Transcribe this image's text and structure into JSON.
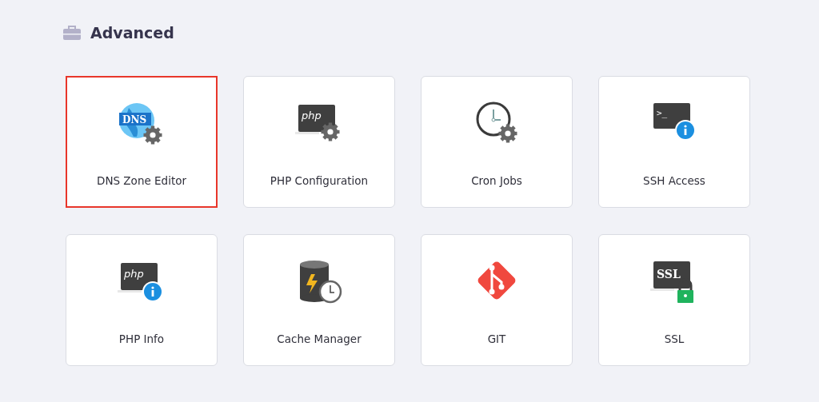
{
  "section": {
    "title": "Advanced"
  },
  "tools": [
    {
      "label": "DNS Zone Editor",
      "kind": "dns",
      "icon_text": "DNS",
      "selected": true
    },
    {
      "label": "PHP Configuration",
      "kind": "php-config",
      "icon_text": "php",
      "selected": false
    },
    {
      "label": "Cron Jobs",
      "kind": "cron",
      "selected": false
    },
    {
      "label": "SSH Access",
      "kind": "ssh",
      "icon_text": ">_",
      "selected": false
    },
    {
      "label": "PHP Info",
      "kind": "php-info",
      "icon_text": "php",
      "selected": false
    },
    {
      "label": "Cache Manager",
      "kind": "cache",
      "selected": false
    },
    {
      "label": "GIT",
      "kind": "git",
      "selected": false
    },
    {
      "label": "SSL",
      "kind": "ssl",
      "icon_text": "SSL",
      "selected": false
    }
  ]
}
